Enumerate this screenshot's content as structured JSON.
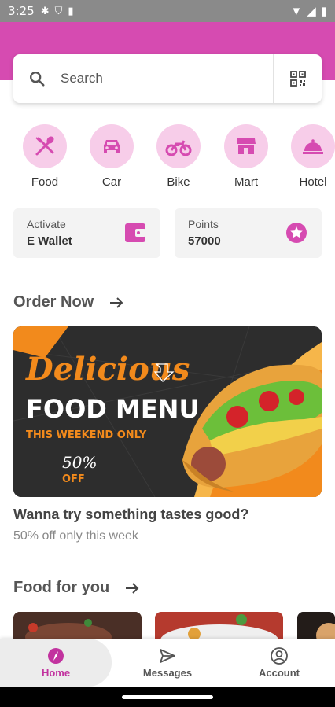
{
  "status_bar": {
    "time": "3:25"
  },
  "search": {
    "placeholder": "Search"
  },
  "categories": [
    {
      "label": "Food",
      "icon": "food-icon"
    },
    {
      "label": "Car",
      "icon": "car-icon"
    },
    {
      "label": "Bike",
      "icon": "bike-icon"
    },
    {
      "label": "Mart",
      "icon": "mart-icon"
    },
    {
      "label": "Hotel",
      "icon": "hotel-icon"
    }
  ],
  "wallet_card": {
    "line1": "Activate",
    "line2": "E Wallet",
    "icon": "wallet-icon"
  },
  "points_card": {
    "line1": "Points",
    "line2": "57000",
    "icon": "star-icon"
  },
  "order_now": {
    "title": "Order Now",
    "banner": {
      "script": "Delicious",
      "headline": "FOOD MENU",
      "subline": "THIS WEEKEND ONLY",
      "discount": "50%",
      "discount_suffix": "OFF"
    },
    "caption_title": "Wanna try something tastes good?",
    "caption_sub": "50% off only this week"
  },
  "food_for_you": {
    "title": "Food for you"
  },
  "bottom_nav": [
    {
      "label": "Home",
      "icon": "home-compass-icon",
      "active": true
    },
    {
      "label": "Messages",
      "icon": "send-icon",
      "active": false
    },
    {
      "label": "Account",
      "icon": "account-icon",
      "active": false
    }
  ],
  "colors": {
    "brand": "#d64bb1",
    "category_bg": "#f7cde9",
    "active_nav": "#c2339f"
  }
}
